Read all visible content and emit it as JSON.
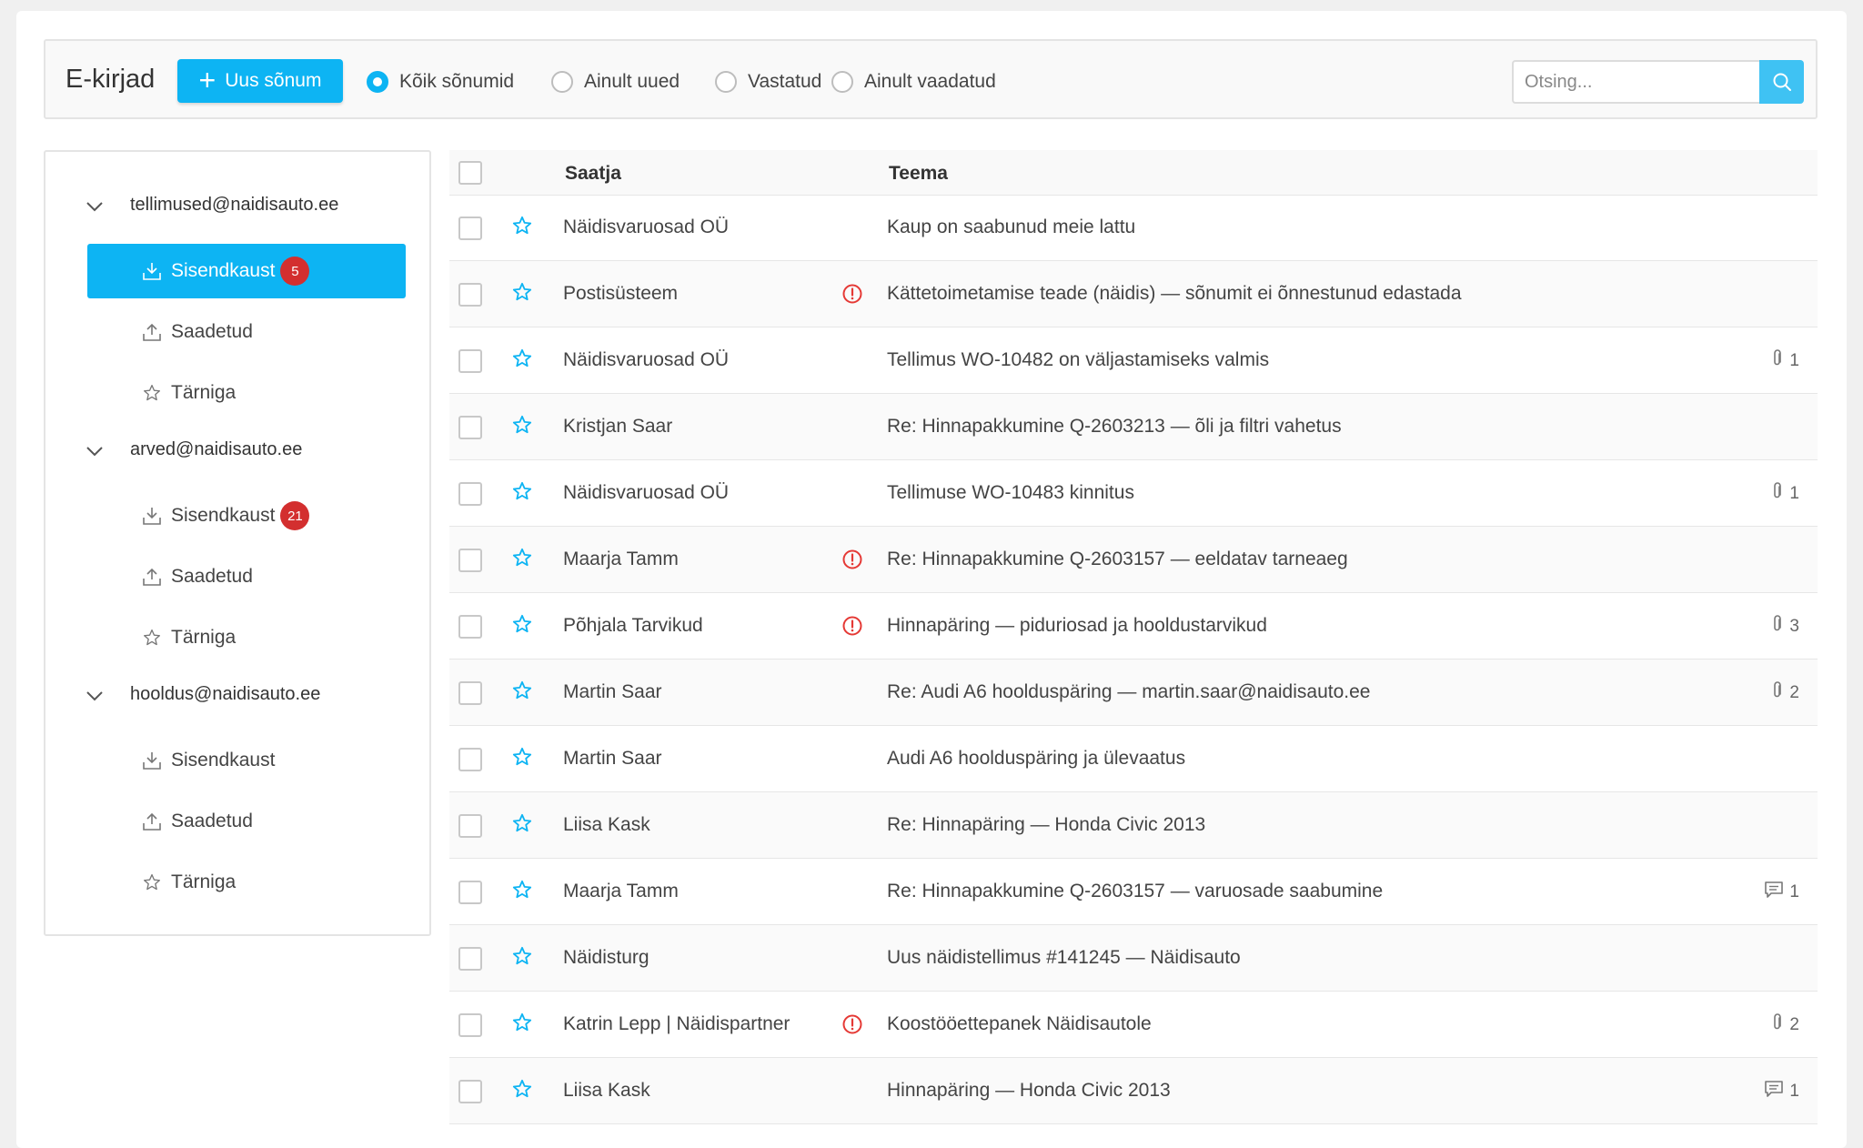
{
  "toolbar": {
    "title": "E-kirjad",
    "new_button": "Uus sõnum",
    "filters": [
      {
        "label": "Kõik sõnumid",
        "checked": true
      },
      {
        "label": "Ainult uued",
        "checked": false
      },
      {
        "label": "Vastatud",
        "checked": false
      },
      {
        "label": "Ainult vaadatud",
        "checked": false
      }
    ],
    "search_placeholder": "Otsing..."
  },
  "sidebar": {
    "accounts": [
      {
        "email": "tellimused@naidisauto.ee",
        "folders": [
          {
            "label": "Sisendkaust",
            "icon": "inbox-icon",
            "badge": "5",
            "active": true
          },
          {
            "label": "Saadetud",
            "icon": "sent-icon",
            "badge": "",
            "active": false
          },
          {
            "label": "Tärniga",
            "icon": "star-icon",
            "badge": "",
            "active": false
          }
        ]
      },
      {
        "email": "arved@naidisauto.ee",
        "folders": [
          {
            "label": "Sisendkaust",
            "icon": "inbox-icon",
            "badge": "21",
            "active": false
          },
          {
            "label": "Saadetud",
            "icon": "sent-icon",
            "badge": "",
            "active": false
          },
          {
            "label": "Tärniga",
            "icon": "star-icon",
            "badge": "",
            "active": false
          }
        ]
      },
      {
        "email": "hooldus@naidisauto.ee",
        "folders": [
          {
            "label": "Sisendkaust",
            "icon": "inbox-icon",
            "badge": "",
            "active": false
          },
          {
            "label": "Saadetud",
            "icon": "sent-icon",
            "badge": "",
            "active": false
          },
          {
            "label": "Tärniga",
            "icon": "star-icon",
            "badge": "",
            "active": false
          }
        ]
      }
    ]
  },
  "table": {
    "columns": {
      "sender": "Saatja",
      "subject": "Teema"
    },
    "rows": [
      {
        "sender": "Näidisvaruosad OÜ",
        "alert": false,
        "subject": "Kaup on saabunud meie lattu",
        "meta_type": "",
        "meta_count": ""
      },
      {
        "sender": "Postisüsteem",
        "alert": true,
        "subject": "Kättetoimetamise teade (näidis) — sõnumit ei õnnestunud edastada",
        "meta_type": "",
        "meta_count": ""
      },
      {
        "sender": "Näidisvaruosad OÜ",
        "alert": false,
        "subject": "Tellimus WO-10482 on väljastamiseks valmis",
        "meta_type": "attachment",
        "meta_count": "1"
      },
      {
        "sender": "Kristjan Saar",
        "alert": false,
        "subject": "Re: Hinnapakkumine Q-2603213 — õli ja filtri vahetus",
        "meta_type": "",
        "meta_count": ""
      },
      {
        "sender": "Näidisvaruosad OÜ",
        "alert": false,
        "subject": "Tellimuse WO-10483 kinnitus",
        "meta_type": "attachment",
        "meta_count": "1"
      },
      {
        "sender": "Maarja Tamm",
        "alert": true,
        "subject": "Re: Hinnapakkumine Q-2603157 — eeldatav tarneaeg",
        "meta_type": "",
        "meta_count": ""
      },
      {
        "sender": "Põhjala Tarvikud",
        "alert": true,
        "subject": "Hinnapäring — piduriosad ja hooldustarvikud",
        "meta_type": "attachment",
        "meta_count": "3"
      },
      {
        "sender": "Martin Saar",
        "alert": false,
        "subject": "Re: Audi A6 hoolduspäring — martin.saar@naidisauto.ee",
        "meta_type": "attachment",
        "meta_count": "2"
      },
      {
        "sender": "Martin Saar",
        "alert": false,
        "subject": "Audi A6 hoolduspäring ja ülevaatus",
        "meta_type": "",
        "meta_count": ""
      },
      {
        "sender": "Liisa Kask",
        "alert": false,
        "subject": "Re: Hinnapäring — Honda Civic 2013",
        "meta_type": "",
        "meta_count": ""
      },
      {
        "sender": "Maarja Tamm",
        "alert": false,
        "subject": "Re: Hinnapakkumine Q-2603157 — varuosade saabumine",
        "meta_type": "comment",
        "meta_count": "1"
      },
      {
        "sender": "Näidisturg",
        "alert": false,
        "subject": "Uus näidistellimus #141245 — Näidisauto",
        "meta_type": "",
        "meta_count": ""
      },
      {
        "sender": "Katrin Lepp | Näidispartner",
        "alert": true,
        "subject": "Koostööettepanek Näidisautole",
        "meta_type": "attachment",
        "meta_count": "2"
      },
      {
        "sender": "Liisa Kask",
        "alert": false,
        "subject": "Hinnapäring — Honda Civic 2013",
        "meta_type": "comment",
        "meta_count": "1"
      }
    ]
  },
  "colors": {
    "accent": "#0db4f3",
    "badge": "#d32f2f",
    "alert": "#e53935"
  }
}
